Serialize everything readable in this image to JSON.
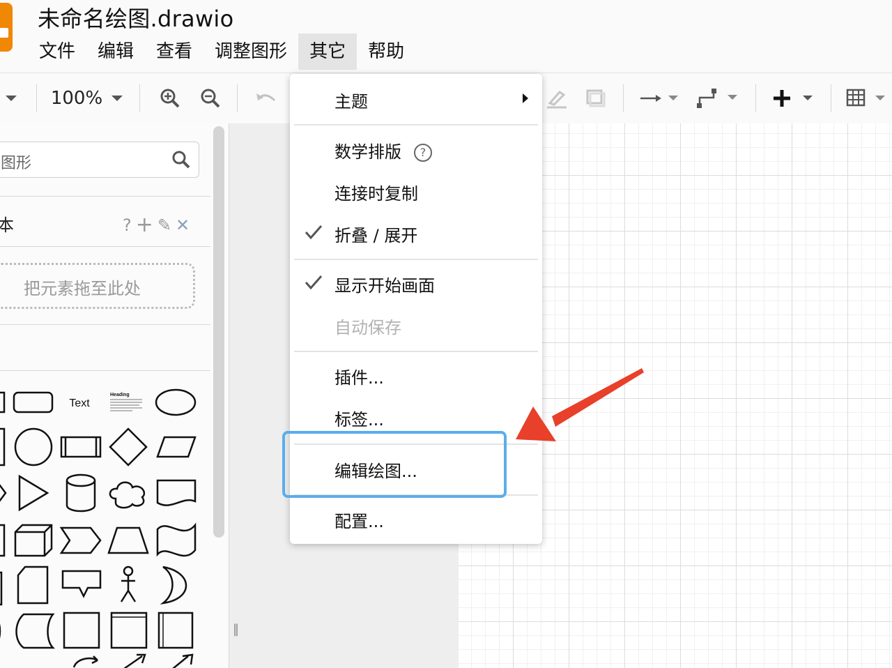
{
  "app": {
    "title": "未命名绘图.drawio",
    "logo_color": "#f08705"
  },
  "menubar": {
    "items": [
      {
        "label": "文件"
      },
      {
        "label": "编辑"
      },
      {
        "label": "查看"
      },
      {
        "label": "调整图形"
      },
      {
        "label": "其它",
        "active": true
      },
      {
        "label": "帮助"
      }
    ]
  },
  "toolbar": {
    "zoom": "100%",
    "icons": [
      "chevron-down-icon",
      "zoom-in-icon",
      "zoom-out-icon",
      "undo-icon",
      "line-color-icon",
      "shadow-icon",
      "connection-arrow-icon",
      "waypoints-icon",
      "insert-plus-icon",
      "table-icon"
    ]
  },
  "sidebar": {
    "search_placeholder": "图形",
    "scratchpad_title": "本",
    "scratchpad_actions": {
      "help": "?",
      "add": "+",
      "edit": "✎",
      "close": "✕"
    },
    "drop_text": "把元素拖至此处",
    "shape_text": "Text",
    "shape_heading": "Heading"
  },
  "dropdown": {
    "items": [
      {
        "label": "主题",
        "submenu": true
      },
      {
        "label": "数学排版",
        "help": "?"
      },
      {
        "label": "连接时复制"
      },
      {
        "label": "折叠 / 展开",
        "checked": true
      },
      {
        "label": "显示开始画面",
        "checked": true
      },
      {
        "label": "自动保存",
        "disabled": true
      },
      {
        "label": "插件..."
      },
      {
        "label": "标签..."
      },
      {
        "label": "编辑绘图...",
        "highlighted": true
      },
      {
        "label": "配置..."
      }
    ]
  },
  "annotation": {
    "highlight_color": "#5aaeea",
    "arrow_color": "#e8402a"
  }
}
